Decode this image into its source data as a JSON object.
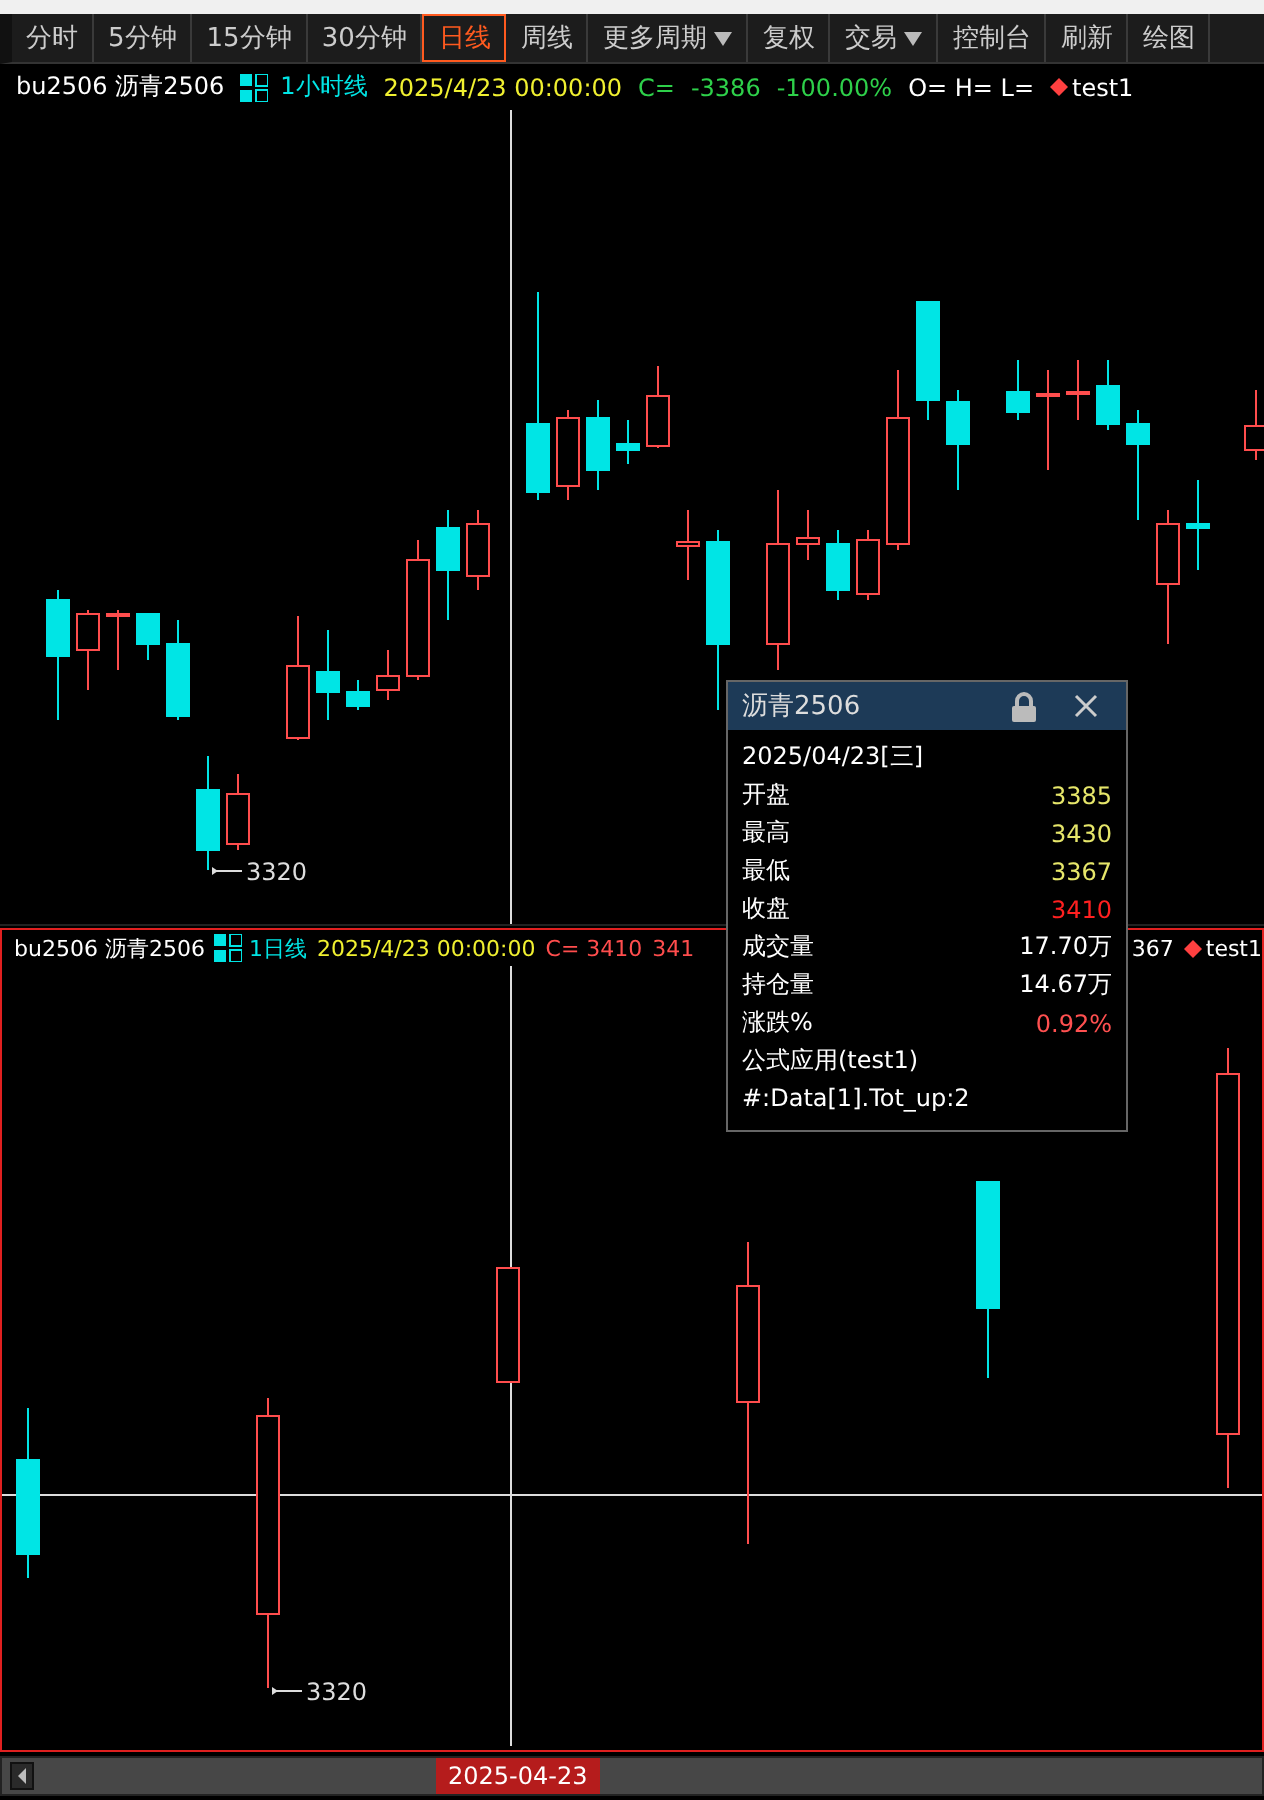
{
  "toolbar": {
    "tabs": [
      {
        "label": "分时",
        "selected": false,
        "dropdown": false
      },
      {
        "label": "5分钟",
        "selected": false,
        "dropdown": false
      },
      {
        "label": "15分钟",
        "selected": false,
        "dropdown": false
      },
      {
        "label": "30分钟",
        "selected": false,
        "dropdown": false
      },
      {
        "label": "日线",
        "selected": true,
        "dropdown": false
      },
      {
        "label": "周线",
        "selected": false,
        "dropdown": false
      },
      {
        "label": "更多周期",
        "selected": false,
        "dropdown": true
      },
      {
        "label": "复权",
        "selected": false,
        "dropdown": false
      },
      {
        "label": "交易",
        "selected": false,
        "dropdown": true
      },
      {
        "label": "控制台",
        "selected": false,
        "dropdown": false
      },
      {
        "label": "刷新",
        "selected": false,
        "dropdown": false
      },
      {
        "label": "绘图",
        "selected": false,
        "dropdown": false
      }
    ]
  },
  "top_panel": {
    "header": {
      "symbol": "bu2506 沥青2506",
      "period": "1小时线",
      "datetime": "2025/4/23 00:00:00",
      "close_label": "C=",
      "close": "-3386",
      "change": "-100.00%",
      "ohl": "O= H= L=",
      "indicator": "test1"
    },
    "low_label": "3320"
  },
  "bottom_panel": {
    "header": {
      "symbol": "bu2506 沥青2506",
      "period": "1日线",
      "datetime": "2025/4/23 00:00:00",
      "close": "C= 3410",
      "change_part": "341",
      "low_part": "367",
      "indicator": "test1"
    },
    "low_label": "3320"
  },
  "popup": {
    "title": "沥青2506",
    "date": "2025/04/23[三]",
    "rows": [
      {
        "label": "开盘",
        "value": "3385",
        "color": "#e6e66a"
      },
      {
        "label": "最高",
        "value": "3430",
        "color": "#e6e66a"
      },
      {
        "label": "最低",
        "value": "3367",
        "color": "#e6e66a"
      },
      {
        "label": "收盘",
        "value": "3410",
        "color": "#ff2020"
      },
      {
        "label": "成交量",
        "value": "17.70万",
        "color": "#ffffff"
      },
      {
        "label": "持仓量",
        "value": "14.67万",
        "color": "#ffffff"
      },
      {
        "label": "涨跌%",
        "value": "0.92%",
        "color": "#ff5050"
      }
    ],
    "formula": [
      "公式应用(test1)",
      "#:Data[1].Tot_up:2"
    ]
  },
  "scrollbar": {
    "date": "2025-04-23"
  }
}
